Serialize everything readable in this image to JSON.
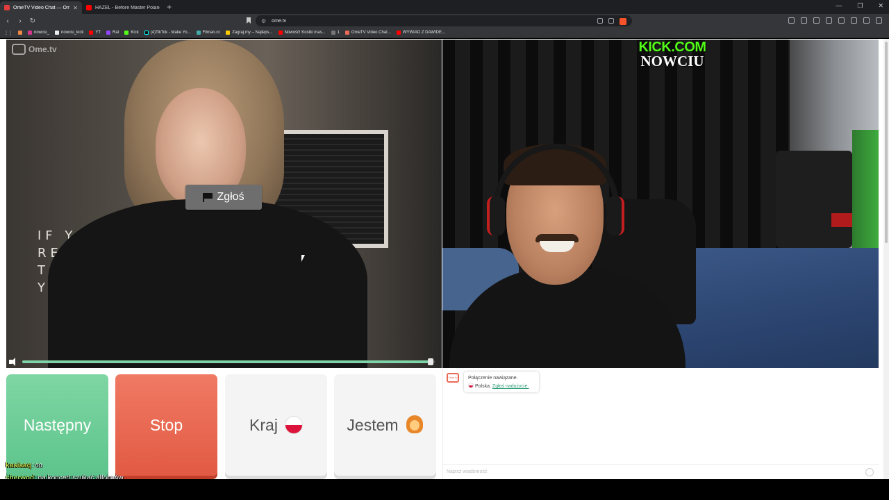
{
  "browser": {
    "tabs": [
      {
        "title": "OmeTV Video Chat — Omeg",
        "active": true
      },
      {
        "title": "HAZEL - Before Master Poland Dj Ba",
        "active": false
      }
    ],
    "url": "ome.tv",
    "bookmarks": [
      "nowciu_",
      "nowciu_kick",
      "YT",
      "Rat",
      "Kick",
      "(4)TikTok - Make Yo...",
      "Filman.cc",
      "Zagraj.my – Najleps...",
      "Nowość! Kostki mas...",
      "1",
      "OmeTV Video Chat...",
      "WYWIAD Z DAWIDE..."
    ]
  },
  "video": {
    "logo_text": "Ome.tv",
    "report_label": "Zgłoś",
    "volume_level": 0.99,
    "wall_text": "IF YO\nREAD\nTHIS\nYO",
    "overlay_line1": "KICK.COM",
    "overlay_line2": "NOWCIU"
  },
  "controls": {
    "next_label": "Następny",
    "stop_label": "Stop",
    "country_label": "Kraj",
    "gender_label": "Jestem"
  },
  "chat": {
    "status": "Połączenie nawiązane.",
    "country": "Polska.",
    "report_link": "Zgłoś nadużycie.",
    "input_placeholder": "Napisz wiadomość",
    "ome_badge": "Ome tv"
  },
  "stream_chat": [
    {
      "user": "kasiaaq",
      "text": ": co"
    },
    {
      "user": "sherwod",
      "text": ": na koncert szukać alfonsów"
    }
  ],
  "colors": {
    "next": "#5dc48c",
    "stop": "#e25a43",
    "kick_green": "#53fc18"
  }
}
